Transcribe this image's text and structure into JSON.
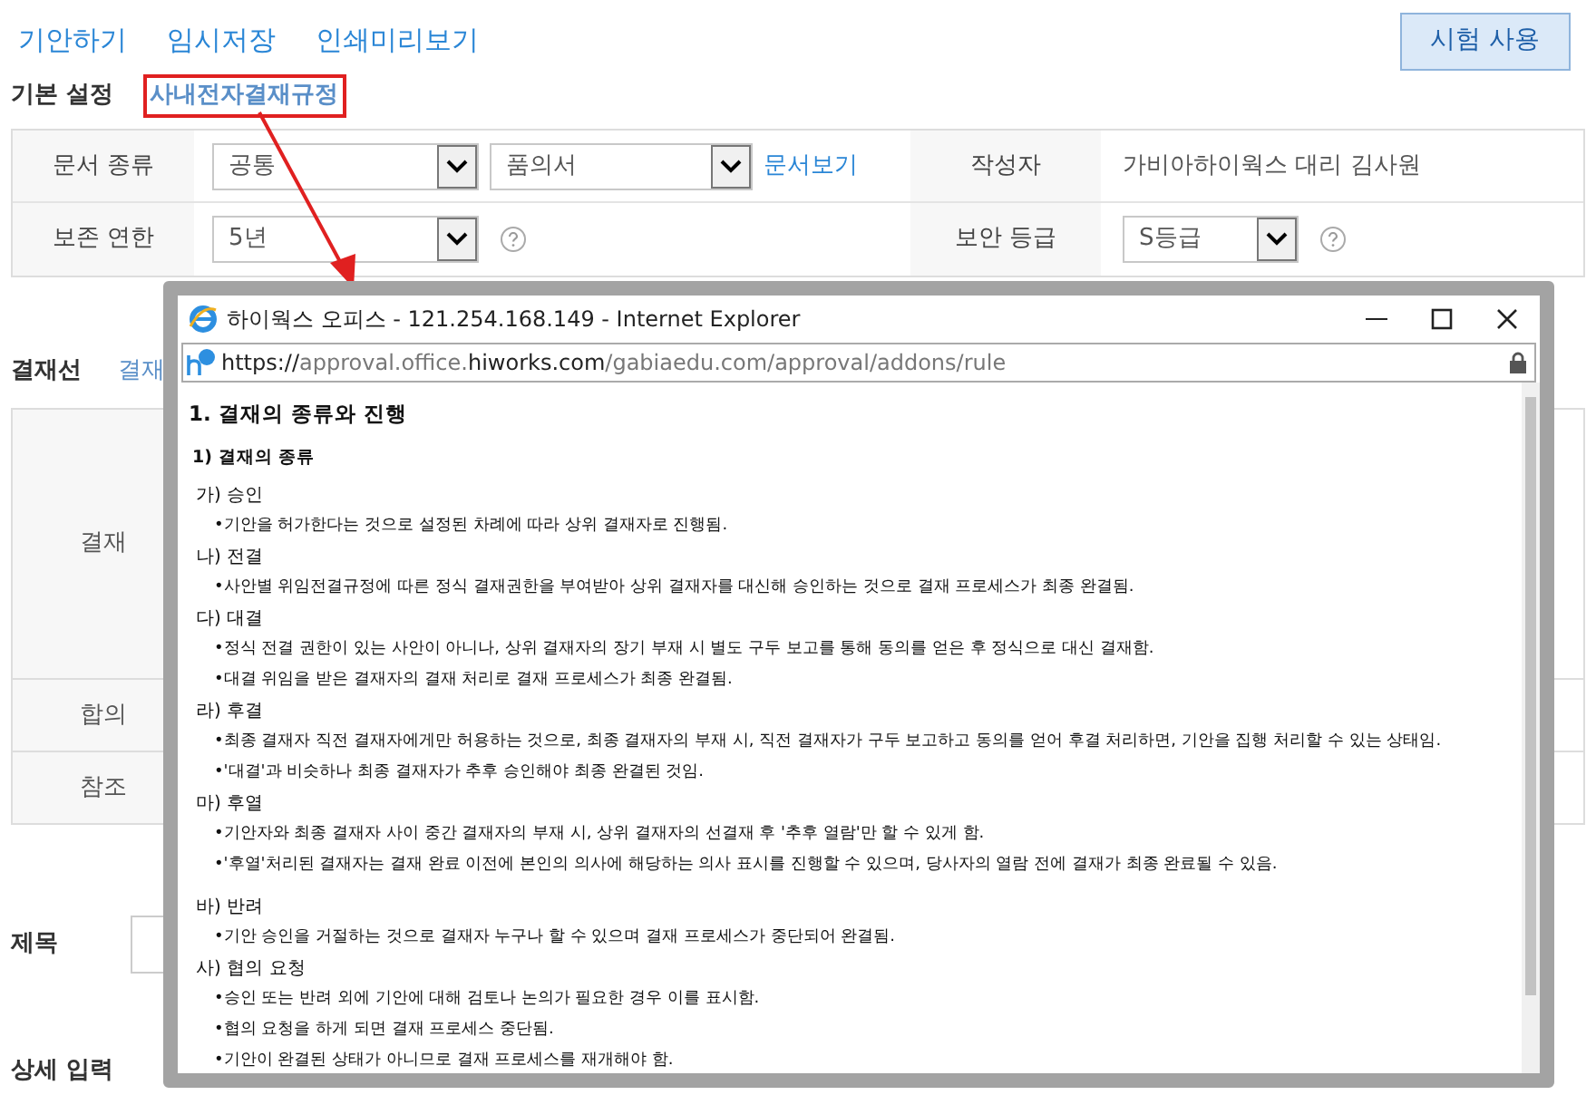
{
  "toolbar": {
    "links": [
      "기안하기",
      "임시저장",
      "인쇄미리보기"
    ],
    "trial_button": "시험 사용"
  },
  "basic": {
    "label": "기본 설정",
    "rule_link": "사내전자결재규정"
  },
  "doc_form": {
    "doc_type_label": "문서 종류",
    "doc_type_value": "공통",
    "form_value": "품의서",
    "view_link": "문서보기",
    "author_label": "작성자",
    "author_value": "가비아하이웍스 대리 김사원",
    "retention_label": "보존 연한",
    "retention_value": "5년",
    "security_label": "보안 등급",
    "security_value": "S등급"
  },
  "approval_line": {
    "label": "결재선",
    "link": "결재",
    "rows": [
      "결재",
      "합의",
      "참조"
    ]
  },
  "subject": {
    "label": "제목"
  },
  "detail": {
    "label": "상세 입력"
  },
  "popup": {
    "title": "하이웍스 오피스 - 121.254.168.149 - Internet Explorer",
    "url_scheme": "https://",
    "url_sub": "approval.office.",
    "url_host": "hiworks.com",
    "url_path": "/gabiaedu.com/approval/addons/rule",
    "heading": "1. 결재의 종류와 진행",
    "subheading": "1) 결재의 종류",
    "sections": [
      {
        "label": "가) 승인",
        "items": [
          "•기안을 허가한다는 것으로 설정된 차례에 따라 상위 결재자로 진행됨."
        ]
      },
      {
        "label": "나) 전결",
        "items": [
          "•사안별 위임전결규정에 따른 정식 결재권한을 부여받아 상위 결재자를 대신해 승인하는 것으로 결재 프로세스가 최종 완결됨."
        ]
      },
      {
        "label": "다) 대결",
        "items": [
          "•정식 전결 권한이 있는 사안이 아니나, 상위 결재자의 장기 부재 시 별도 구두 보고를 통해 동의를 얻은 후 정식으로 대신 결재함.",
          "•대결 위임을 받은 결재자의 결재 처리로 결재 프로세스가 최종 완결됨."
        ]
      },
      {
        "label": "라) 후결",
        "items": [
          "•최종 결재자 직전 결재자에게만 허용하는 것으로, 최종 결재자의 부재 시, 직전 결재자가 구두 보고하고 동의를 얻어 후결 처리하면, 기안을 집행 처리할 수 있는 상태임.",
          "•'대결'과 비슷하나 최종 결재자가 추후 승인해야 최종 완결된 것임."
        ]
      },
      {
        "label": "마) 후열",
        "items": [
          "•기안자와 최종 결재자 사이 중간 결재자의 부재 시, 상위 결재자의 선결재 후 '추후 열람'만 할 수 있게 함.",
          "•'후열'처리된 결재자는 결재 완료 이전에 본인의 의사에 해당하는 의사 표시를 진행할 수 있으며, 당사자의 열람 전에 결재가 최종 완료될 수 있음."
        ]
      },
      {
        "label": "바) 반려",
        "items": [
          "•기안 승인을 거절하는 것으로 결재자 누구나 할 수 있으며 결재 프로세스가 중단되어 완결됨."
        ]
      },
      {
        "label": "사) 협의 요청",
        "items": [
          "•승인 또는 반려 외에 기안에 대해 검토나 논의가 필요한 경우 이를 표시함.",
          "•협의 요청을 하게 되면 결재 프로세스 중단됨.",
          "•기안이 완결된 상태가 아니므로 결재 프로세스를 재개해야 함."
        ]
      }
    ]
  }
}
